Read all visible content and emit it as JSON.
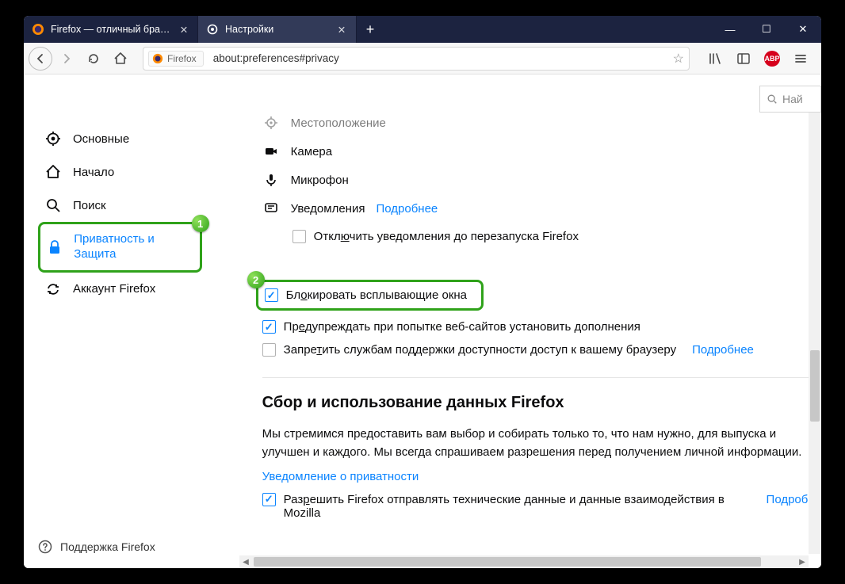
{
  "tabs": [
    {
      "label": "Firefox — отличный браузер д",
      "active": false
    },
    {
      "label": "Настройки",
      "active": true
    }
  ],
  "toolbar": {
    "firefox_pill": "Firefox",
    "url": "about:preferences#privacy"
  },
  "settings_search_placeholder": "Най",
  "sidebar": {
    "items": [
      {
        "key": "general",
        "label": "Основные"
      },
      {
        "key": "home",
        "label": "Начало"
      },
      {
        "key": "search",
        "label": "Поиск"
      },
      {
        "key": "privacy",
        "label": "Приватность и Защита",
        "selected": true
      },
      {
        "key": "account",
        "label": "Аккаунт Firefox"
      }
    ],
    "support": "Поддержка Firefox"
  },
  "annotations": {
    "badge1": "1",
    "badge2": "2"
  },
  "permissions": {
    "location": "Местоположение",
    "camera": "Камера",
    "microphone": "Микрофон",
    "notifications": "Уведомления",
    "more": "Подробнее",
    "disable_notifications": {
      "checked": false,
      "pre": "Откл",
      "u": "ю",
      "post": "чить уведомления до перезапуска Firefox"
    }
  },
  "popups": {
    "block_popups": {
      "checked": true,
      "pre": "Бл",
      "u": "о",
      "post": "кировать всплывающие окна"
    },
    "warn_addons": {
      "checked": true,
      "pre": "Пр",
      "u": "е",
      "post": "дупреждать при попытке веб-сайтов установить дополнения"
    },
    "a11y": {
      "checked": false,
      "pre": "Запре",
      "u": "т",
      "post": "ить службам поддержки доступности доступ к вашему браузеру"
    },
    "a11y_more": "Подробнее"
  },
  "datacollect": {
    "heading": "Сбор и использование данных Firefox",
    "para": "Мы стремимся предоставить вам выбор и собирать только то, что нам нужно, для выпуска и улучшен и каждого. Мы всегда спрашиваем разрешения перед получением личной информации.",
    "privacy_notice": "Уведомление о приватности",
    "telemetry": {
      "checked": true,
      "pre": "Раз",
      "u": "р",
      "post": "ешить Firefox отправлять технические данные и данные взаимодействия в Mozilla"
    },
    "telemetry_more": "Подробне"
  }
}
